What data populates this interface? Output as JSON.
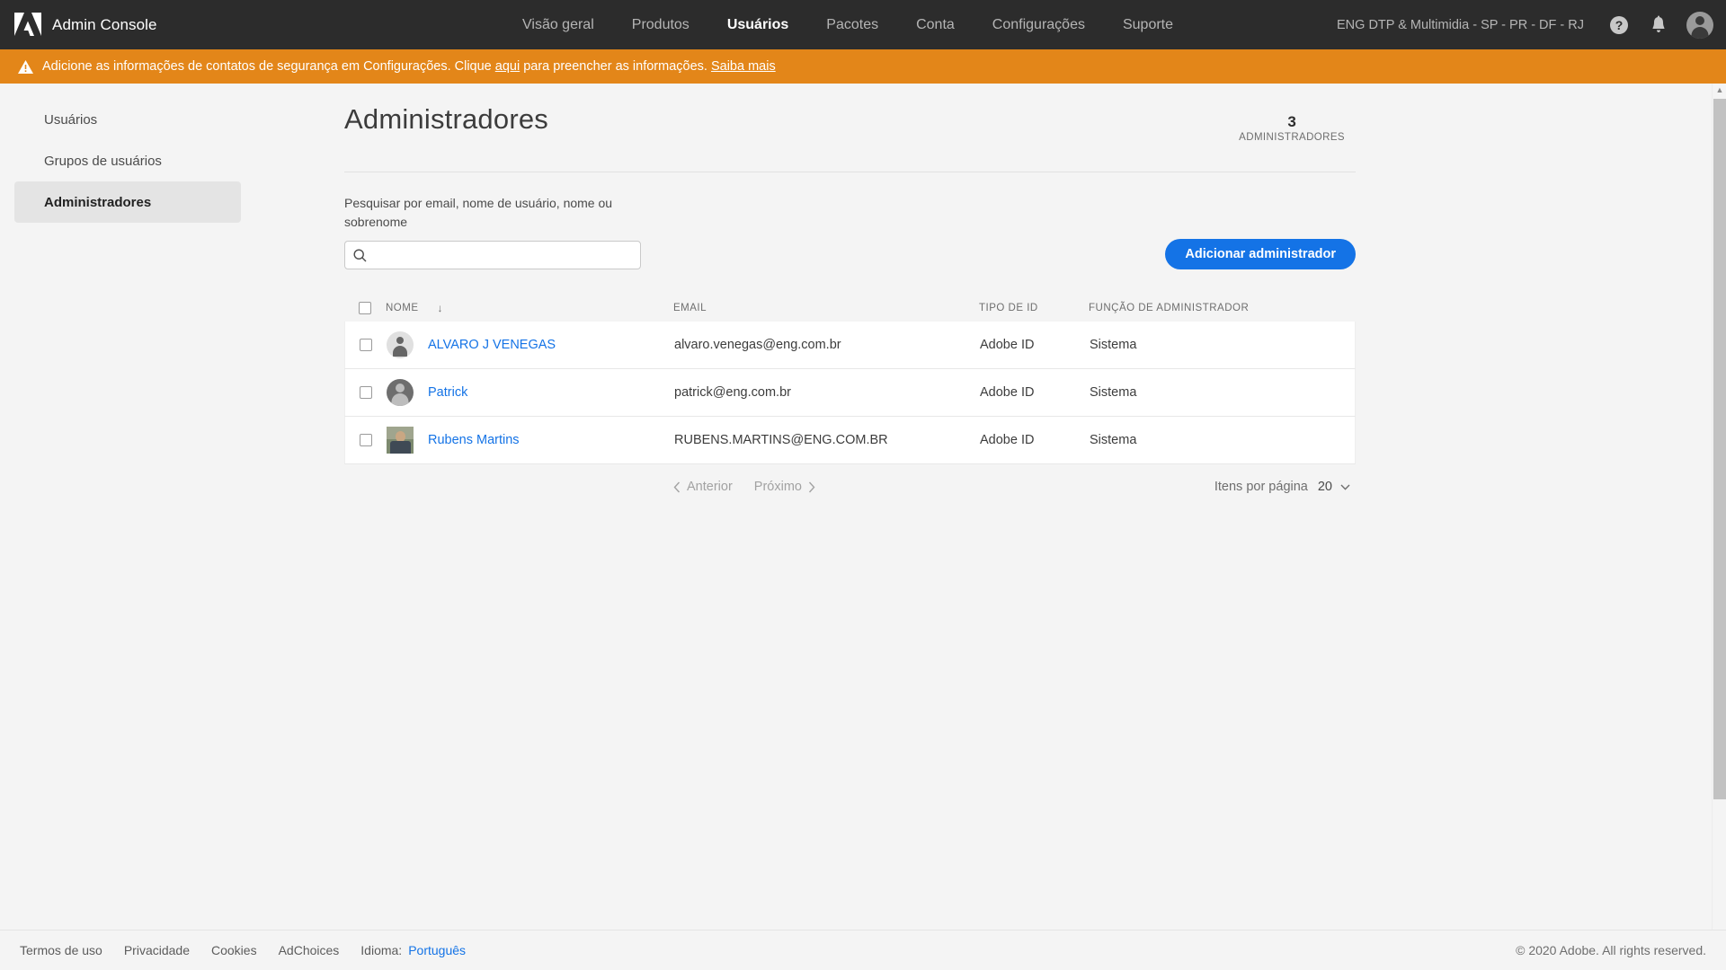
{
  "topnav": {
    "logo_icon": "adobe-logo",
    "title": "Admin Console",
    "links": [
      {
        "label": "Visão geral",
        "active": false
      },
      {
        "label": "Produtos",
        "active": false
      },
      {
        "label": "Usuários",
        "active": true
      },
      {
        "label": "Pacotes",
        "active": false
      },
      {
        "label": "Conta",
        "active": false
      },
      {
        "label": "Configurações",
        "active": false
      },
      {
        "label": "Suporte",
        "active": false
      }
    ],
    "org_name": "ENG DTP & Multimidia - SP - PR - DF - RJ",
    "help_icon": "help-circle-icon",
    "bell_icon": "notification-bell-icon",
    "avatar_icon": "user-avatar-icon"
  },
  "banner": {
    "warning_icon": "warning-triangle-icon",
    "text_before": "Adicione as informações de contatos de segurança em Configurações. Clique ",
    "link_inline": "aqui",
    "text_after": " para preencher as informações. ",
    "link_more": "Saiba mais"
  },
  "sidebar": {
    "items": [
      {
        "label": "Usuários",
        "selected": false
      },
      {
        "label": "Grupos de usuários",
        "selected": false
      },
      {
        "label": "Administradores",
        "selected": true
      }
    ]
  },
  "main": {
    "page_title": "Administradores",
    "count_number": "3",
    "count_label": "ADMINISTRADORES",
    "search": {
      "label": "Pesquisar por email, nome de usuário, nome ou sobrenome",
      "icon": "search-icon",
      "value": "",
      "placeholder": ""
    },
    "add_admin_button": "Adicionar administrador",
    "table": {
      "select_all_icon": "checkbox-unchecked-icon",
      "columns": [
        {
          "key": "name",
          "label": "NOME",
          "sorted": true,
          "sort_icon": "arrow-down-icon"
        },
        {
          "key": "email",
          "label": "EMAIL",
          "sorted": false
        },
        {
          "key": "idtype",
          "label": "TIPO DE ID",
          "sorted": false
        },
        {
          "key": "role",
          "label": "FUNÇÃO DE ADMINISTRADOR",
          "sorted": false
        }
      ],
      "rows": [
        {
          "checkbox_icon": "checkbox-unchecked-icon",
          "avatar": "circle-light",
          "name": "ALVARO J VENEGAS",
          "email": "alvaro.venegas@eng.com.br",
          "idtype": "Adobe ID",
          "role": "Sistema"
        },
        {
          "checkbox_icon": "checkbox-unchecked-icon",
          "avatar": "circle-dark",
          "name": "Patrick",
          "email": "patrick@eng.com.br",
          "idtype": "Adobe ID",
          "role": "Sistema"
        },
        {
          "checkbox_icon": "checkbox-unchecked-icon",
          "avatar": "photo",
          "name": "Rubens Martins",
          "email": "RUBENS.MARTINS@ENG.COM.BR",
          "idtype": "Adobe ID",
          "role": "Sistema"
        }
      ]
    },
    "pagination": {
      "prev_icon": "chevron-left-icon",
      "prev_label": "Anterior",
      "next_label": "Próximo",
      "next_icon": "chevron-right-icon",
      "per_page_label": "Itens por página",
      "per_page_value": "20",
      "per_page_icon": "chevron-down-icon"
    }
  },
  "scrollbar": {
    "up_icon": "scroll-up-arrow-icon"
  },
  "footer": {
    "links": [
      "Termos de uso",
      "Privacidade",
      "Cookies",
      "AdChoices"
    ],
    "language_label": "Idioma:",
    "language_value": "Português",
    "copyright": "© 2020 Adobe. All rights reserved."
  },
  "colors": {
    "nav_bg": "#2c2c2c",
    "banner_bg": "#e38619",
    "accent_blue": "#1473e6",
    "page_bg": "#f4f4f4"
  }
}
